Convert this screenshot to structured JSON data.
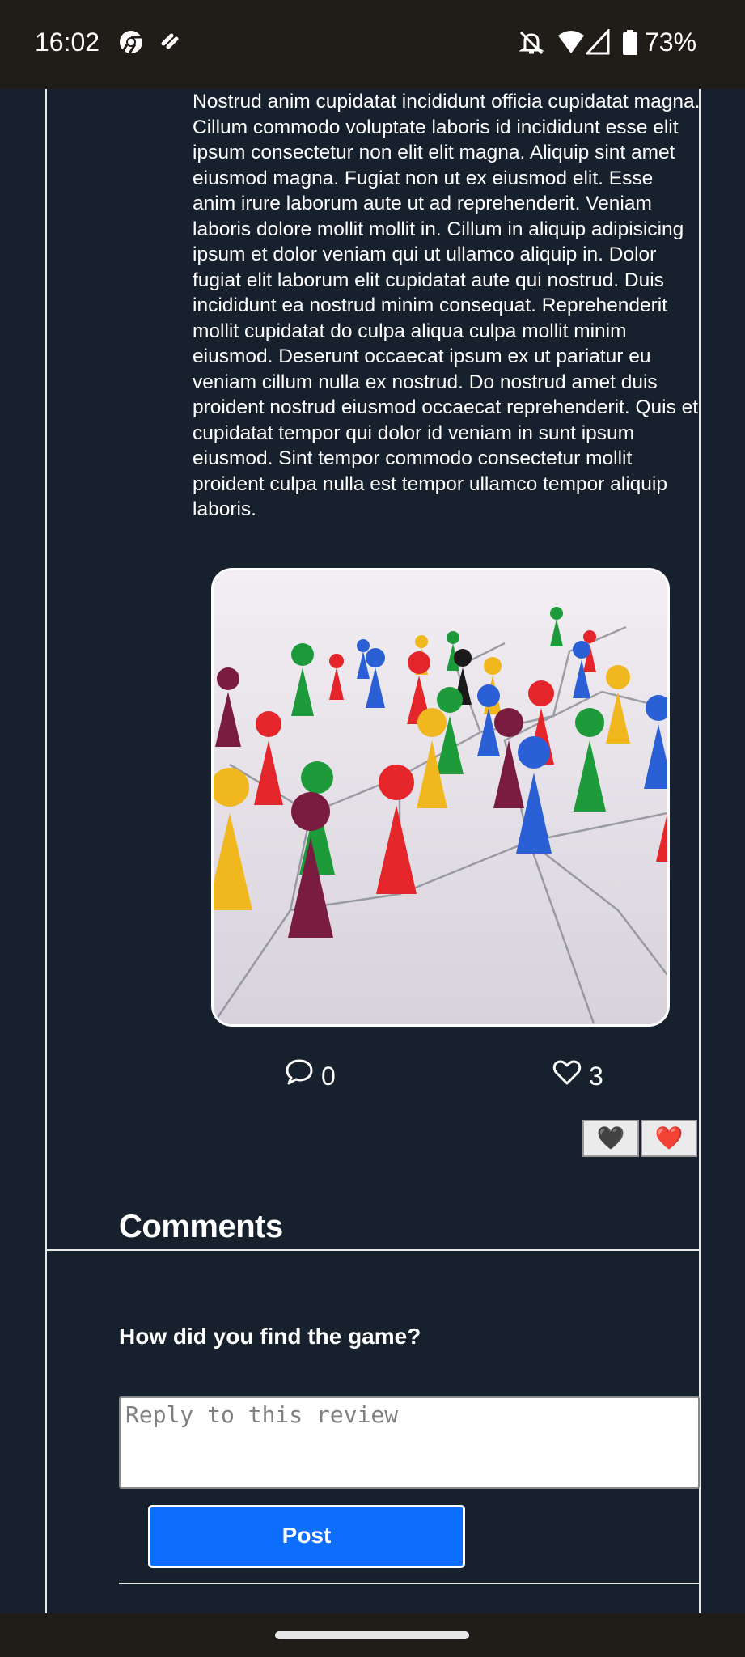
{
  "status_bar": {
    "time": "16:02",
    "battery": "73%",
    "icons": [
      "chrome-icon",
      "link-icon",
      "notifications-off-icon",
      "wifi-icon",
      "cell-signal-icon",
      "battery-icon"
    ]
  },
  "review": {
    "body": "Nostrud anim cupidatat incididunt officia cupidatat magna. Cillum commodo voluptate laboris id incididunt esse elit ipsum consectetur non elit elit magna. Aliquip sint amet eiusmod magna. Fugiat non ut ex eiusmod elit. Esse anim irure laborum aute ut ad reprehenderit. Veniam laboris dolore mollit mollit in. Cillum in aliquip adipisicing ipsum et dolor veniam qui ut ullamco aliquip in. Dolor fugiat elit laborum elit cupidatat aute qui nostrud. Duis incididunt ea nostrud minim consequat. Reprehenderit mollit cupidatat do culpa aliqua culpa mollit minim eiusmod. Deserunt occaecat ipsum ex ut pariatur eu veniam cillum nulla ex nostrud. Do nostrud amet duis proident nostrud eiusmod occaecat reprehenderit. Quis et cupidatat tempor qui dolor id veniam in sunt ipsum eiusmod. Sint tempor commodo consectetur mollit proident culpa nulla est tempor ullamco tempor aliquip laboris.",
    "comment_count": "0",
    "like_count": "3",
    "reactions": [
      "🖤",
      "❤️"
    ]
  },
  "comments": {
    "heading": "Comments",
    "question": "How did you find the game?",
    "reply_placeholder": "Reply to this review",
    "post_label": "Post"
  },
  "colors": {
    "background": "#17212e",
    "system_bars": "#201c18",
    "primary_button": "#0d6efd"
  }
}
